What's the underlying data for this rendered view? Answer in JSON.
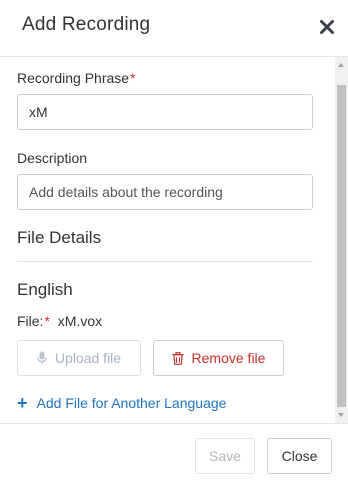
{
  "dialog": {
    "title": "Add Recording",
    "close_icon": "close-icon"
  },
  "form": {
    "phrase_label": "Recording Phrase",
    "required_mark": "*",
    "phrase_value": "xM",
    "description_label": "Description",
    "description_placeholder": "Add details about the recording",
    "description_value": ""
  },
  "file_details": {
    "heading": "File Details",
    "language": "English",
    "file_label": "File:",
    "file_name": "xM.vox",
    "upload_label": "Upload file",
    "upload_icon": "microphone-icon",
    "remove_label": "Remove file",
    "remove_icon": "trash-icon",
    "add_language_label": "Add File for Another Language",
    "add_language_icon": "plus-icon"
  },
  "footer": {
    "save_label": "Save",
    "close_label": "Close"
  },
  "colors": {
    "required": "#c9302c",
    "link": "#1f74c0",
    "danger": "#c9302c",
    "disabled_text": "#a9b4c4"
  }
}
